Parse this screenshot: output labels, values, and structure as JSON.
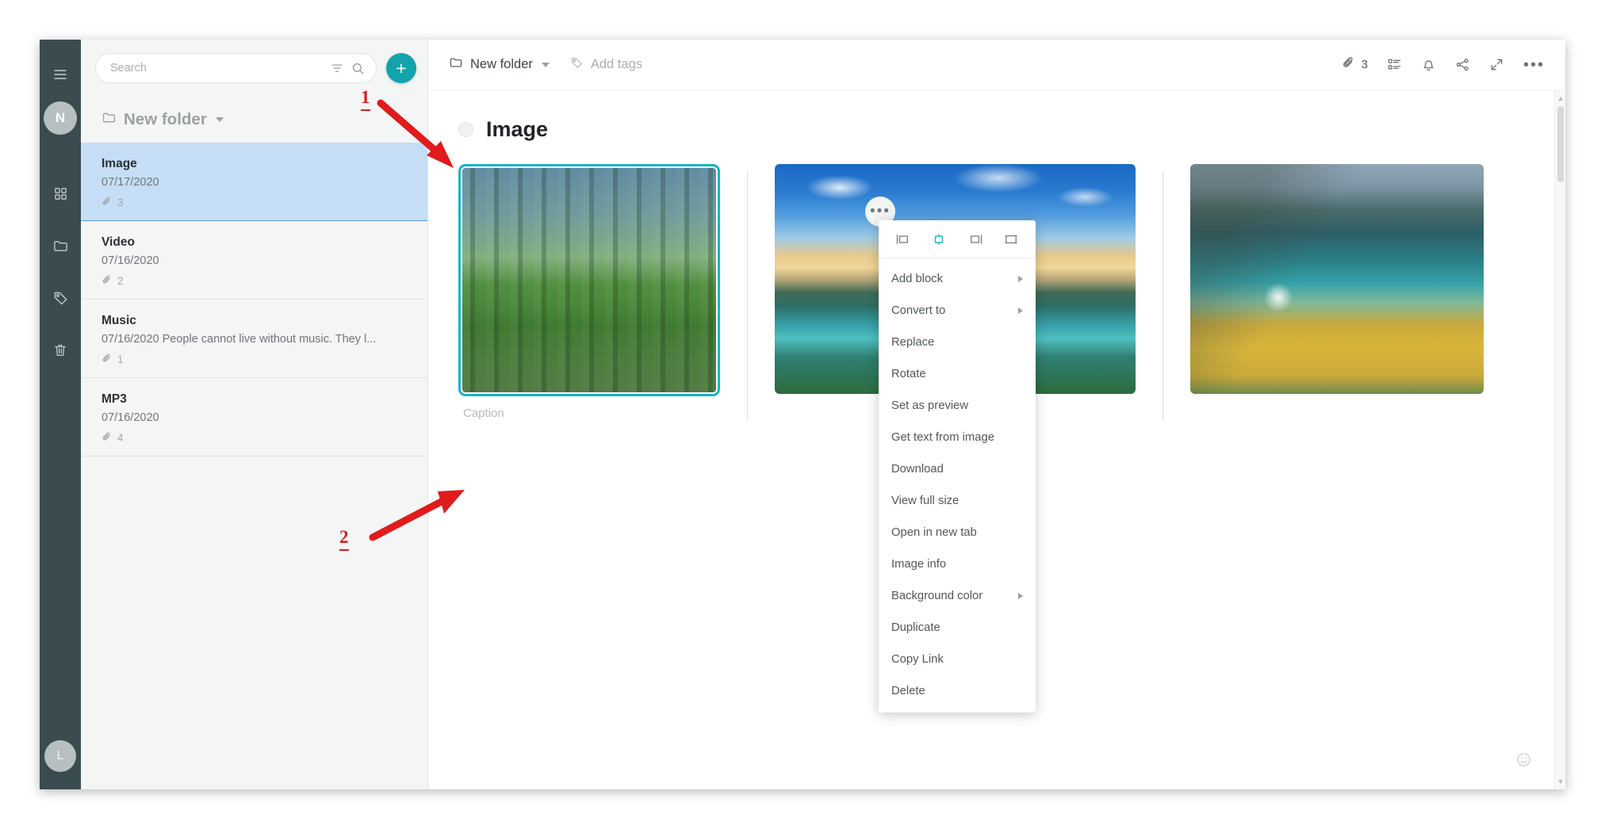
{
  "app": {
    "accent_color": "#12a3ab",
    "selection_color": "#15b4c6",
    "rail_color": "#3b4c50",
    "annotation_color": "#d81f1f"
  },
  "rail": {
    "menu_icon": "hamburger-icon",
    "avatar_initial": "N",
    "items": [
      {
        "icon": "grid-icon",
        "label": "All notes"
      },
      {
        "icon": "folder-icon",
        "label": "Folders"
      },
      {
        "icon": "tag-icon",
        "label": "Tags"
      },
      {
        "icon": "trash-icon",
        "label": "Trash"
      }
    ],
    "bottom_avatar_initial": "L"
  },
  "search": {
    "placeholder": "Search",
    "value": "",
    "filter_icon": "filter-icon",
    "search_icon": "search-icon"
  },
  "add_button": {
    "label": "+"
  },
  "list_header": {
    "folder_icon": "folder-icon",
    "folder_name": "New folder",
    "caret": "chevron-down-icon"
  },
  "notes": [
    {
      "title": "Image",
      "preview": "07/17/2020",
      "attachments": "3",
      "selected": true
    },
    {
      "title": "Video",
      "preview": "07/16/2020",
      "attachments": "2",
      "selected": false
    },
    {
      "title": "Music",
      "preview": "07/16/2020 People cannot live without music. They l...",
      "attachments": "1",
      "selected": false
    },
    {
      "title": "MP3",
      "preview": "07/16/2020",
      "attachments": "4",
      "selected": false
    }
  ],
  "editor": {
    "breadcrumb_folder": "New folder",
    "add_tags_label": "Add tags",
    "attachment_count": "3",
    "toolbar": {
      "attachment_icon": "paperclip-icon",
      "outline_icon": "outline-list-icon",
      "reminder_icon": "bell-icon",
      "share_icon": "share-icon",
      "expand_icon": "expand-icon",
      "more_icon": "more-horizontal-icon"
    },
    "note_title": "Image",
    "images": [
      {
        "alt": "forest-path-photo",
        "caption": "Caption",
        "selected": true
      },
      {
        "alt": "lake-sunrise-photo",
        "caption": "",
        "selected": false
      },
      {
        "alt": "autumn-lake-photo",
        "caption": "",
        "selected": false
      }
    ],
    "smiley_icon": "smiley-icon"
  },
  "context_menu": {
    "trigger_icon": "more-horizontal-icon",
    "alignment": [
      {
        "name": "align-left",
        "active": false
      },
      {
        "name": "align-center",
        "active": true
      },
      {
        "name": "align-right",
        "active": false
      },
      {
        "name": "align-full-width",
        "active": false
      }
    ],
    "items": [
      {
        "label": "Add block",
        "submenu": true
      },
      {
        "label": "Convert to",
        "submenu": true
      },
      {
        "label": "Replace",
        "submenu": false
      },
      {
        "label": "Rotate",
        "submenu": false
      },
      {
        "label": "Set as preview",
        "submenu": false
      },
      {
        "label": "Get text from image",
        "submenu": false
      },
      {
        "label": "Download",
        "submenu": false
      },
      {
        "label": "View full size",
        "submenu": false
      },
      {
        "label": "Open in new tab",
        "submenu": false
      },
      {
        "label": "Image info",
        "submenu": false
      },
      {
        "label": "Background color",
        "submenu": true
      },
      {
        "label": "Duplicate",
        "submenu": false
      },
      {
        "label": "Copy Link",
        "submenu": false
      },
      {
        "label": "Delete",
        "submenu": false
      }
    ]
  },
  "annotations": [
    {
      "number": "1",
      "points_to": "context-menu-trigger"
    },
    {
      "number": "2",
      "points_to": "menu-item-open-in-new-tab"
    }
  ]
}
